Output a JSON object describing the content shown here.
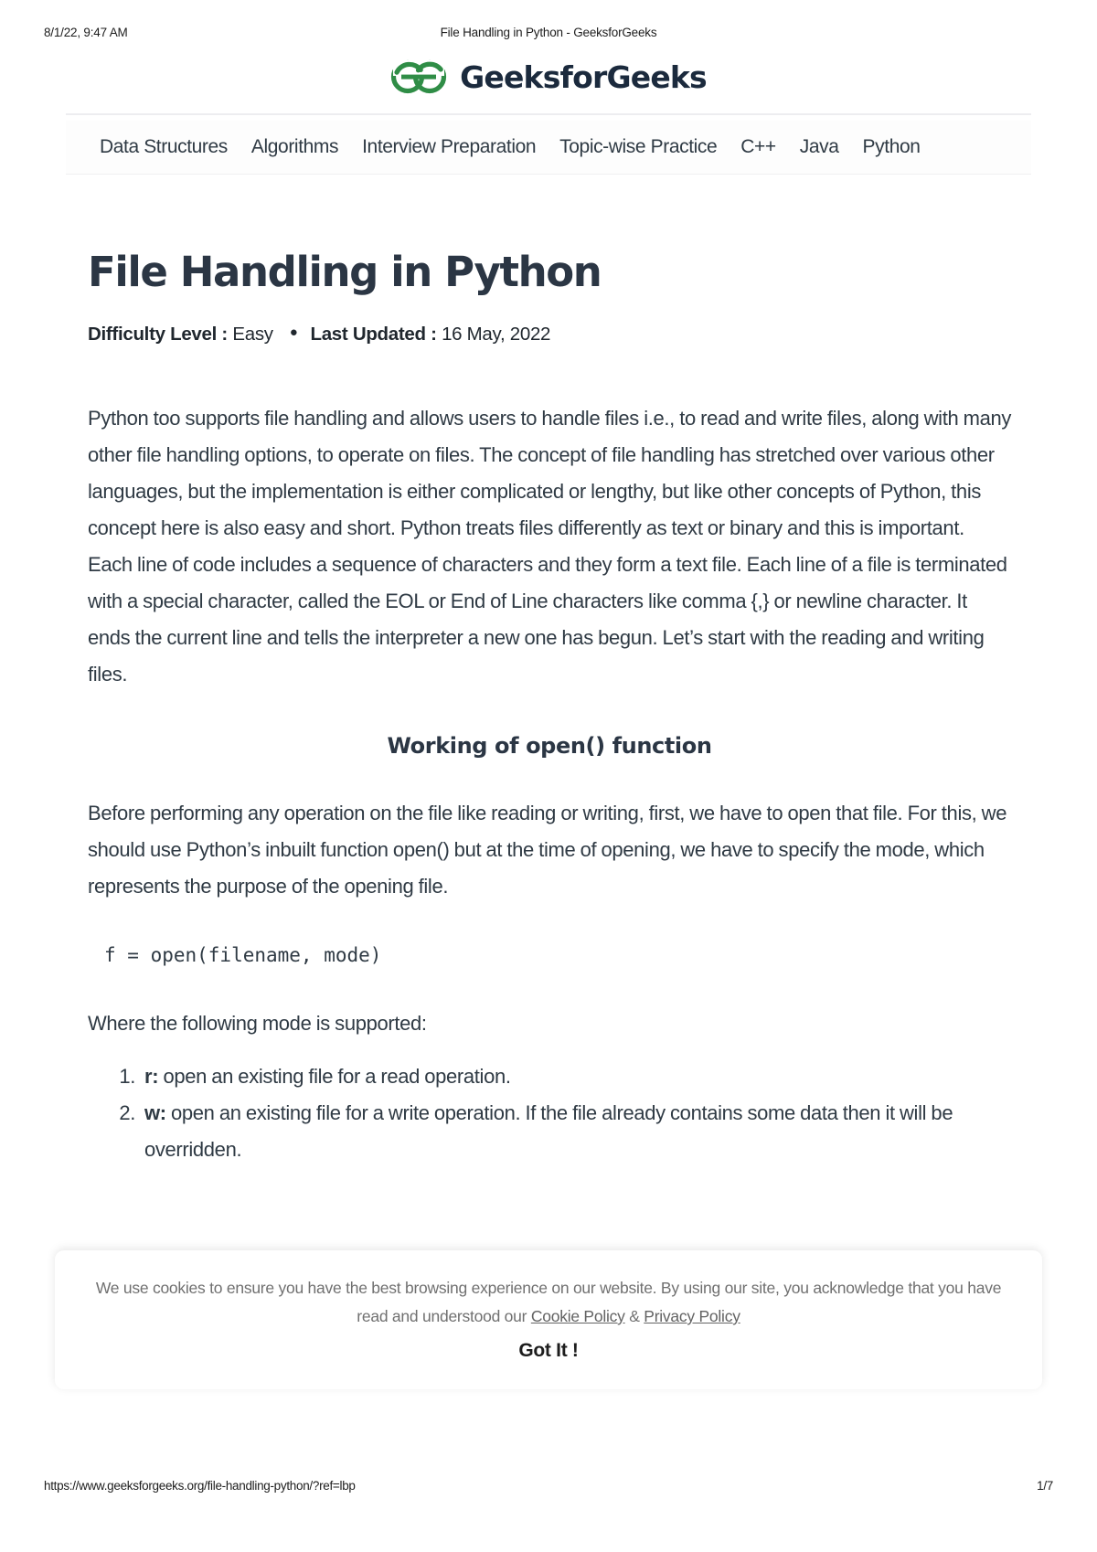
{
  "print": {
    "date": "8/1/22, 9:47 AM",
    "doc_title": "File Handling in Python - GeeksforGeeks",
    "url": "https://www.geeksforgeeks.org/file-handling-python/?ref=lbp",
    "page_number": "1/7"
  },
  "brand": {
    "name": "GeeksforGeeks",
    "logo_icon": "geeksforgeeks-logo-icon",
    "logo_color": "#2f8d46",
    "name_color": "#1b2a3d"
  },
  "nav": {
    "items": [
      {
        "label": "Data Structures"
      },
      {
        "label": "Algorithms"
      },
      {
        "label": "Interview Preparation"
      },
      {
        "label": "Topic-wise Practice"
      },
      {
        "label": "C++"
      },
      {
        "label": "Java"
      },
      {
        "label": "Python"
      }
    ]
  },
  "article": {
    "title": "File Handling in Python",
    "meta": {
      "difficulty_label": "Difficulty Level :",
      "difficulty_value": "Easy",
      "separator": "●",
      "updated_label": "Last Updated :",
      "updated_value": "16 May, 2022"
    },
    "intro_paragraph": "Python too supports file handling and allows users to handle files i.e., to read and write files, along with many other file handling options, to operate on files. The concept of file handling has stretched over various other languages, but the implementation is either complicated or lengthy, but like other concepts of Python, this concept here is also easy and short. Python treats files differently as text or binary and this is important. Each line of code includes a sequence of characters and they form a text file. Each line of a file is terminated with a special character, called the EOL or End of Line characters like comma {,} or newline character. It ends the current line and tells the interpreter a new one has begun. Let’s start with the reading and writing files.",
    "section_heading": "Working of open() function",
    "open_paragraph": "Before performing any operation on the file like reading or writing, first, we have to open that file. For this, we should use Python’s inbuilt function open() but at the time of opening, we have to specify the mode, which represents the purpose of the opening file.",
    "code_snippet": "f = open(filename, mode)",
    "where_paragraph": "Where the following mode is supported:",
    "modes": [
      {
        "flag": "r:",
        "description": " open an existing file for a read operation."
      },
      {
        "flag": "w:",
        "description": " open an existing file for a write operation. If the file already contains some data then it will be overridden."
      }
    ]
  },
  "cookie_banner": {
    "text_before": "We use cookies to ensure you have the best browsing experience on our website. By using our site, you acknowledge that you have read and understood our ",
    "cookie_policy_link": "Cookie Policy",
    "amp": " & ",
    "privacy_policy_link": "Privacy Policy",
    "button_label": "Got It !"
  }
}
